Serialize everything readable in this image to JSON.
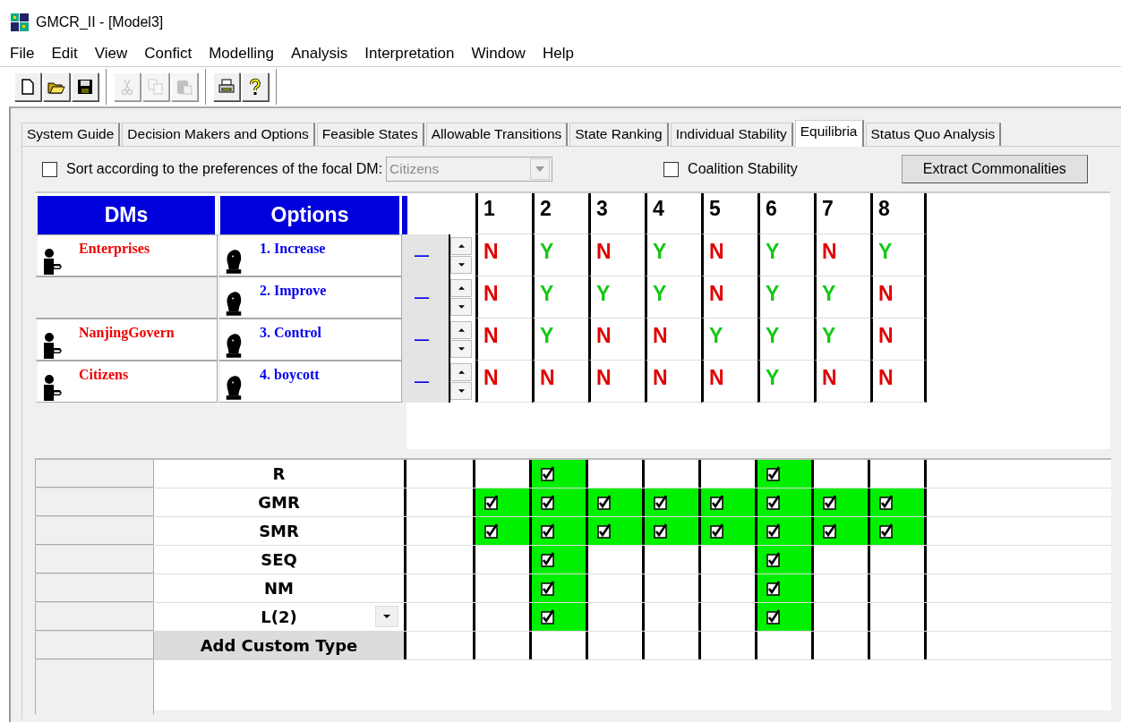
{
  "window": {
    "title": "GMCR_II - [Model3]"
  },
  "menu": [
    "File",
    "Edit",
    "View",
    "Confict",
    "Modelling",
    "Analysis",
    "Interpretation",
    "Window",
    "Help"
  ],
  "toolbar": [
    [
      {
        "kind": "new",
        "disabled": false
      },
      {
        "kind": "open",
        "disabled": false
      },
      {
        "kind": "save",
        "disabled": false
      }
    ],
    [
      {
        "kind": "cut",
        "disabled": true
      },
      {
        "kind": "copy",
        "disabled": true
      },
      {
        "kind": "paste",
        "disabled": true
      }
    ],
    [
      {
        "kind": "print",
        "disabled": false
      },
      {
        "kind": "help",
        "disabled": false
      }
    ]
  ],
  "tabs": [
    {
      "label": "System Guide",
      "selected": false
    },
    {
      "label": "Decision Makers and Options",
      "selected": false
    },
    {
      "label": "Feasible States",
      "selected": false
    },
    {
      "label": "Allowable Transitions",
      "selected": false
    },
    {
      "label": "State Ranking",
      "selected": false
    },
    {
      "label": "Individual Stability",
      "selected": false
    },
    {
      "label": "Equilibria",
      "selected": true
    },
    {
      "label": "Status Quo Analysis",
      "selected": false
    }
  ],
  "sort_option": {
    "label": "Sort according to the preferences of the focal DM:",
    "checked": false,
    "focal_dm": {
      "value": "Citizens",
      "disabled": true
    }
  },
  "coalition_stability": {
    "label": "Coalition Stability",
    "checked": false
  },
  "extract_button": "Extract Commonalities",
  "options_table": {
    "columns": [
      "DMs",
      "Options"
    ],
    "states": [
      "1",
      "2",
      "3",
      "4",
      "5",
      "6",
      "7",
      "8"
    ],
    "rows": [
      {
        "dm": "Enterprises",
        "option": "1. Increase",
        "marker": "—",
        "cells": [
          {
            "text": "N",
            "color": "#e00000"
          },
          {
            "text": "Y",
            "color": "#14c814"
          },
          {
            "text": "N",
            "color": "#e00000"
          },
          {
            "text": "Y",
            "color": "#14c814"
          },
          {
            "text": "N",
            "color": "#e00000"
          },
          {
            "text": "Y",
            "color": "#14c814"
          },
          {
            "text": "N",
            "color": "#e00000"
          },
          {
            "text": "Y",
            "color": "#14c814"
          }
        ]
      },
      {
        "option": "2. Improve",
        "marker": "—",
        "cells": [
          {
            "text": "N",
            "color": "#e00000"
          },
          {
            "text": "Y",
            "color": "#14c814"
          },
          {
            "text": "Y",
            "color": "#14c814"
          },
          {
            "text": "Y",
            "color": "#14c814"
          },
          {
            "text": "N",
            "color": "#e00000"
          },
          {
            "text": "Y",
            "color": "#14c814"
          },
          {
            "text": "Y",
            "color": "#14c814"
          },
          {
            "text": "N",
            "color": "#e00000"
          }
        ]
      },
      {
        "dm": "NanjingGovern",
        "option": "3. Control",
        "marker": "—",
        "cells": [
          {
            "text": "N",
            "color": "#e00000"
          },
          {
            "text": "Y",
            "color": "#14c814"
          },
          {
            "text": "N",
            "color": "#e00000"
          },
          {
            "text": "N",
            "color": "#e00000"
          },
          {
            "text": "Y",
            "color": "#14c814"
          },
          {
            "text": "Y",
            "color": "#14c814"
          },
          {
            "text": "Y",
            "color": "#14c814"
          },
          {
            "text": "N",
            "color": "#e00000"
          }
        ]
      },
      {
        "dm": "Citizens",
        "option": "4. boycott",
        "marker": "—",
        "cells": [
          {
            "text": "N",
            "color": "#e00000"
          },
          {
            "text": "N",
            "color": "#e00000"
          },
          {
            "text": "N",
            "color": "#e00000"
          },
          {
            "text": "N",
            "color": "#e00000"
          },
          {
            "text": "N",
            "color": "#e00000"
          },
          {
            "text": "Y",
            "color": "#14c814"
          },
          {
            "text": "N",
            "color": "#e00000"
          },
          {
            "text": "N",
            "color": "#e00000"
          }
        ]
      }
    ]
  },
  "stability": {
    "rows": [
      {
        "kind": "label",
        "name": "R",
        "checks": [
          false,
          true,
          false,
          false,
          false,
          true,
          false,
          false
        ]
      },
      {
        "kind": "label",
        "name": "GMR",
        "checks": [
          true,
          true,
          true,
          true,
          true,
          true,
          true,
          true
        ]
      },
      {
        "kind": "label",
        "name": "SMR",
        "checks": [
          true,
          true,
          true,
          true,
          true,
          true,
          true,
          true
        ]
      },
      {
        "kind": "label",
        "name": "SEQ",
        "checks": [
          false,
          true,
          false,
          false,
          false,
          true,
          false,
          false
        ]
      },
      {
        "kind": "label",
        "name": "NM",
        "checks": [
          false,
          true,
          false,
          false,
          false,
          true,
          false,
          false
        ]
      },
      {
        "kind": "dropdown",
        "name": "L(2)",
        "checks": [
          false,
          true,
          false,
          false,
          false,
          true,
          false,
          false
        ]
      },
      {
        "kind": "button",
        "name": "Add Custom Type",
        "checks": [
          false,
          false,
          false,
          false,
          false,
          false,
          false,
          false
        ]
      }
    ]
  }
}
